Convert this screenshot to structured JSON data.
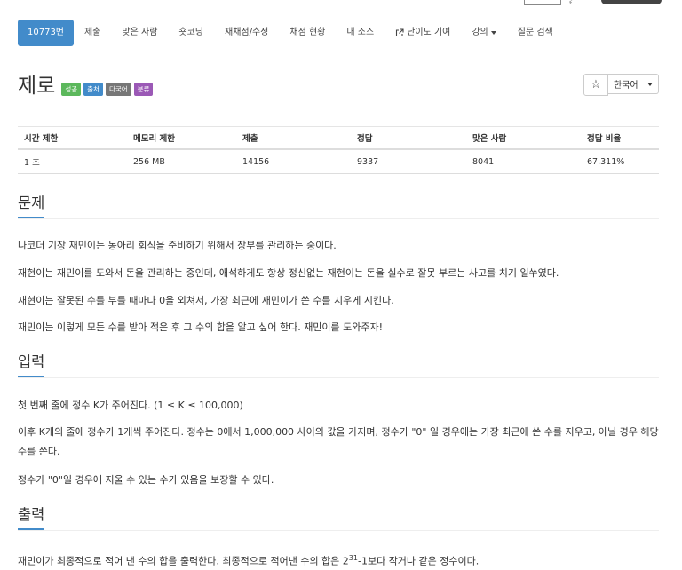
{
  "nav": {
    "items": [
      {
        "name": "problem-id-tab",
        "label": "10773번",
        "active": true
      },
      {
        "name": "submit-tab",
        "label": "제출"
      },
      {
        "name": "solvers-tab",
        "label": "맞은 사람"
      },
      {
        "name": "shortcoding-tab",
        "label": "숏코딩"
      },
      {
        "name": "rejudge-tab",
        "label": "재채점/수정"
      },
      {
        "name": "judge-status-tab",
        "label": "채점 현황"
      },
      {
        "name": "my-source-tab",
        "label": "내 소스"
      },
      {
        "name": "difficulty-tab",
        "label": "난이도 기여",
        "icon": "external-link-icon"
      },
      {
        "name": "lecture-tab",
        "label": "강의",
        "dropdown": true
      },
      {
        "name": "qna-tab",
        "label": "질문 검색"
      }
    ]
  },
  "problem": {
    "title": "제로",
    "badges": [
      "성공",
      "출처",
      "다국어",
      "분류"
    ],
    "star": "☆",
    "language": "한국어"
  },
  "info_table": {
    "headers": [
      "시간 제한",
      "메모리 제한",
      "제출",
      "정답",
      "맞은 사람",
      "정답 비율"
    ],
    "values": [
      "1 초",
      "256 MB",
      "14156",
      "9337",
      "8041",
      "67.311%"
    ]
  },
  "sections": {
    "problem": {
      "heading": "문제",
      "paragraphs": [
        "나코더 기장 재민이는 동아리 회식을 준비하기 위해서 장부를 관리하는 중이다.",
        "재현이는 재민이를 도와서 돈을 관리하는 중인데, 애석하게도 항상 정신없는 재현이는 돈을 실수로 잘못 부르는 사고를 치기 일쑤였다.",
        "재현이는 잘못된 수를 부를 때마다 0을 외쳐서, 가장 최근에 재민이가 쓴 수를 지우게 시킨다.",
        "재민이는 이렇게 모든 수를 받아 적은 후 그 수의 합을 알고 싶어 한다. 재민이를 도와주자!"
      ]
    },
    "input": {
      "heading": "입력",
      "paragraphs": [
        "첫 번째 줄에 정수 K가 주어진다. (1 ≤ K ≤ 100,000)",
        "이후 K개의 줄에 정수가 1개씩 주어진다. 정수는 0에서 1,000,000 사이의 값을 가지며, 정수가 \"0\" 일 경우에는 가장 최근에 쓴 수를 지우고, 아닐 경우 해당 수를 쓴다.",
        "정수가 \"0\"일 경우에 지울 수 있는 수가 있음을 보장할 수 있다."
      ]
    },
    "output": {
      "heading": "출력",
      "text_before": "재민이가 최종적으로 적어 낸 수의 합을 출력한다. 최종적으로 적어낸 수의 합은 2",
      "sup": "31",
      "text_after": "-1보다 작거나 같은 정수이다."
    }
  }
}
